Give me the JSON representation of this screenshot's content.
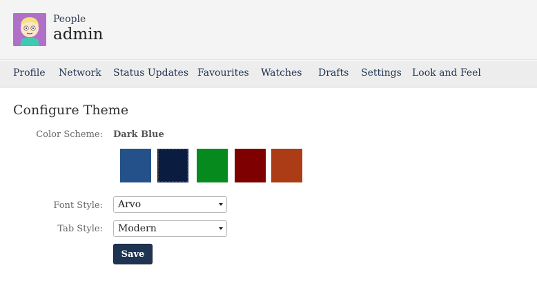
{
  "header": {
    "section": "People",
    "username": "admin"
  },
  "nav": {
    "items": [
      "Profile",
      "Network",
      "Status Updates",
      "Favourites",
      "Watches",
      "Drafts",
      "Settings",
      "Look and Feel"
    ]
  },
  "configure": {
    "title": "Configure Theme",
    "color_scheme_label": "Color Scheme:",
    "color_scheme_value": "Dark Blue",
    "swatches": [
      {
        "color": "#24518a",
        "selected": false
      },
      {
        "color": "#0a1c40",
        "selected": true
      },
      {
        "color": "#068a1e",
        "selected": false
      },
      {
        "color": "#7f0000",
        "selected": false
      },
      {
        "color": "#ac3c15",
        "selected": false
      }
    ],
    "font_style_label": "Font Style:",
    "font_style_value": "Arvo",
    "tab_style_label": "Tab Style:",
    "tab_style_value": "Modern",
    "save_label": "Save"
  }
}
